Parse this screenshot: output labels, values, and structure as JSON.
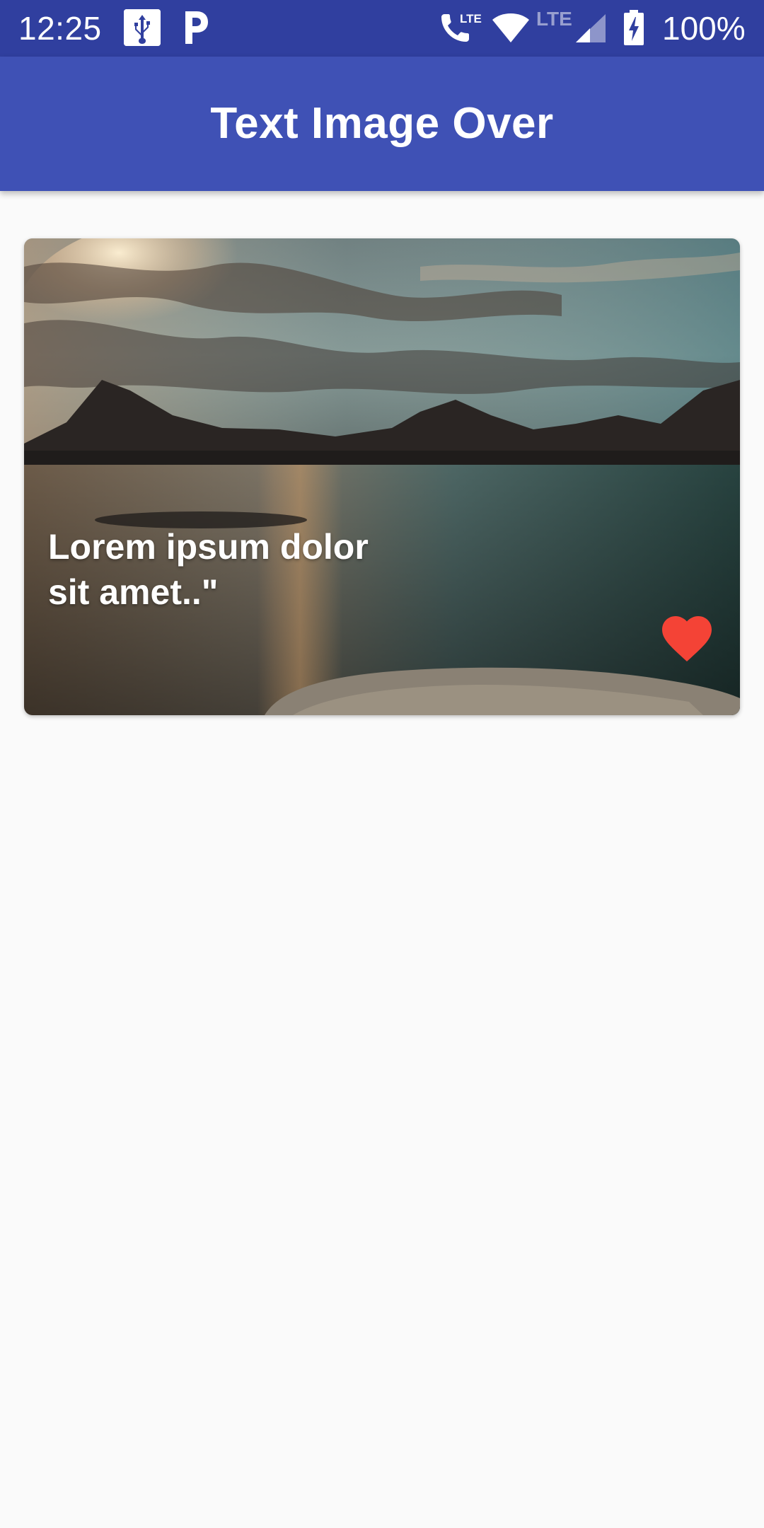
{
  "status_bar": {
    "time": "12:25",
    "battery_percent": "100%",
    "network_label": "LTE",
    "icons": [
      "usb-icon",
      "parking-icon",
      "volte-call-icon",
      "wifi-icon",
      "signal-icon",
      "battery-charging-icon"
    ]
  },
  "app_bar": {
    "title": "Text Image Over",
    "color": "#3f51b5",
    "status_color": "#303f9f"
  },
  "card": {
    "caption": "Lorem ipsum dolor sit amet..\"",
    "image_description_icon": "landscape-image",
    "favorite_icon": "heart-icon",
    "favorite_color": "#f44336"
  }
}
